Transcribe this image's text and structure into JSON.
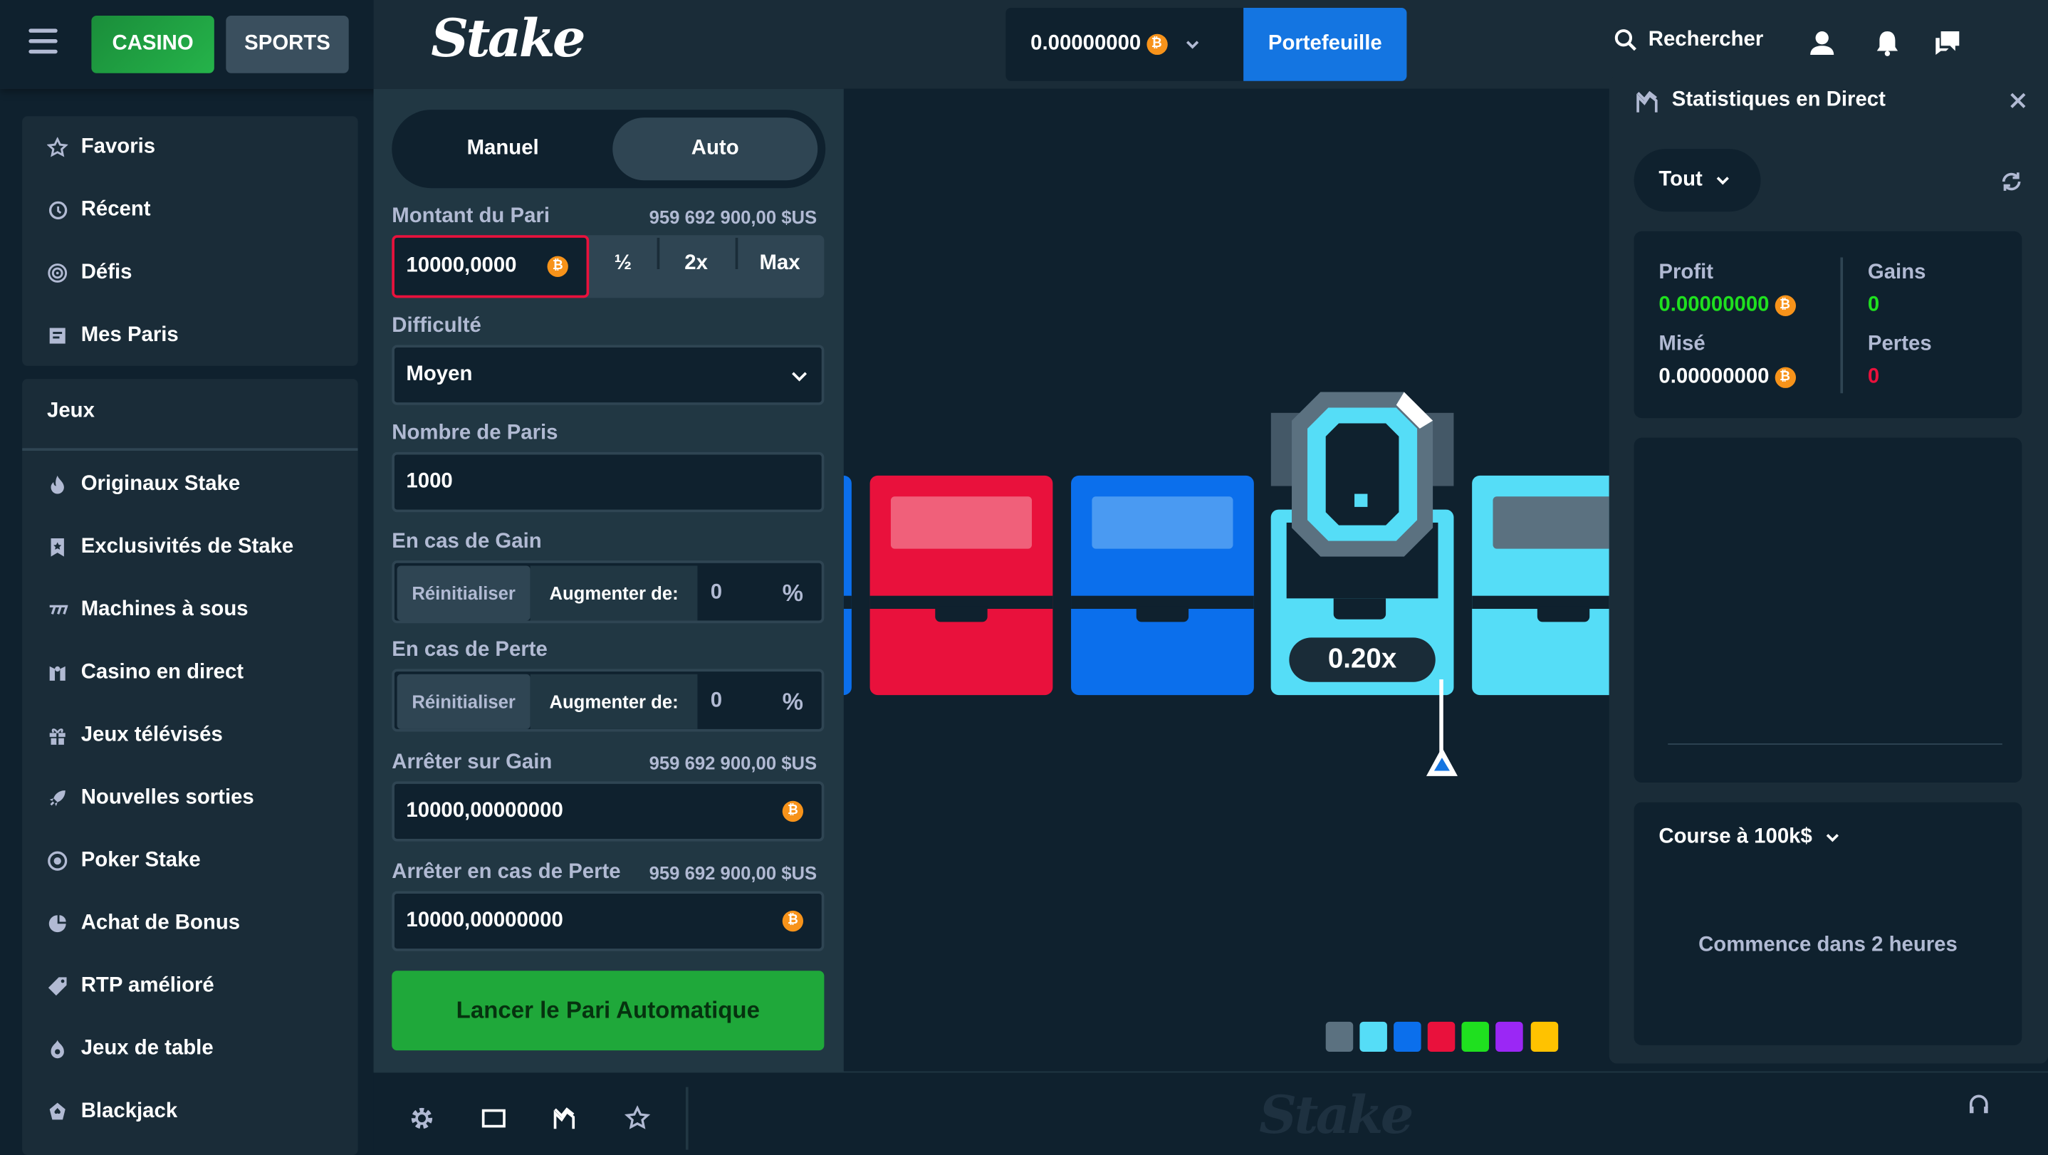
{
  "header": {
    "casino_label": "CASINO",
    "sports_label": "SPORTS",
    "logo": "Stake",
    "balance": "0.00000000",
    "wallet_label": "Portefeuille",
    "search_label": "Rechercher"
  },
  "sidebar": {
    "top_items": [
      {
        "label": "Favoris",
        "icon": "star-icon"
      },
      {
        "label": "Récent",
        "icon": "history-icon"
      },
      {
        "label": "Défis",
        "icon": "target-icon"
      },
      {
        "label": "Mes Paris",
        "icon": "receipt-icon"
      }
    ],
    "games_heading": "Jeux",
    "game_items": [
      {
        "label": "Originaux Stake",
        "icon": "flame-icon"
      },
      {
        "label": "Exclusivités de Stake",
        "icon": "bookmark-star-icon"
      },
      {
        "label": "Machines à sous",
        "icon": "slots-icon"
      },
      {
        "label": "Casino en direct",
        "icon": "live-dealer-icon"
      },
      {
        "label": "Jeux télévisés",
        "icon": "gift-icon"
      },
      {
        "label": "Nouvelles sorties",
        "icon": "rocket-icon"
      },
      {
        "label": "Poker Stake",
        "icon": "poker-chip-icon"
      },
      {
        "label": "Achat de Bonus",
        "icon": "bonus-icon"
      },
      {
        "label": "RTP amélioré",
        "icon": "tag-icon"
      },
      {
        "label": "Jeux de table",
        "icon": "dice-icon"
      },
      {
        "label": "Blackjack",
        "icon": "spade-card-icon"
      }
    ]
  },
  "bet": {
    "mode_manual": "Manuel",
    "mode_auto": "Auto",
    "amount_label": "Montant du Pari",
    "amount_usd": "959 692 900,00 $US",
    "amount_value": "10000,0000",
    "half": "½",
    "double": "2x",
    "max": "Max",
    "difficulty_label": "Difficulté",
    "difficulty_value": "Moyen",
    "num_bets_label": "Nombre de Paris",
    "num_bets_value": "1000",
    "on_win_label": "En cas de Gain",
    "on_loss_label": "En cas de Perte",
    "reset_label": "Réinitialiser",
    "increase_label": "Augmenter de:",
    "win_increase_value": "0",
    "loss_increase_value": "0",
    "percent": "%",
    "stop_profit_label": "Arrêter sur Gain",
    "stop_profit_usd": "959 692 900,00 $US",
    "stop_profit_value": "10000,00000000",
    "stop_loss_label": "Arrêter en cas de Perte",
    "stop_loss_usd": "959 692 900,00 $US",
    "stop_loss_value": "10000,00000000",
    "start_label": "Lancer le Pari Automatique"
  },
  "game": {
    "multiplier": "0.20x",
    "colors": {
      "red": "#e9113c",
      "blue": "#0b6fec",
      "cyan": "#55ddf7",
      "gray": "#5b7180",
      "green": "#1fe01f",
      "purple": "#9b27f5",
      "yellow": "#ffc200"
    }
  },
  "stats": {
    "title": "Statistiques en Direct",
    "filter": "Tout",
    "profit_label": "Profit",
    "profit_value": "0.00000000",
    "wins_label": "Gains",
    "wins_value": "0",
    "wagered_label": "Misé",
    "wagered_value": "0.00000000",
    "losses_label": "Pertes",
    "losses_value": "0",
    "race_label": "Course à 100k$",
    "race_status": "Commence dans 2 heures"
  },
  "bottom": {
    "watermark": "Stake"
  }
}
